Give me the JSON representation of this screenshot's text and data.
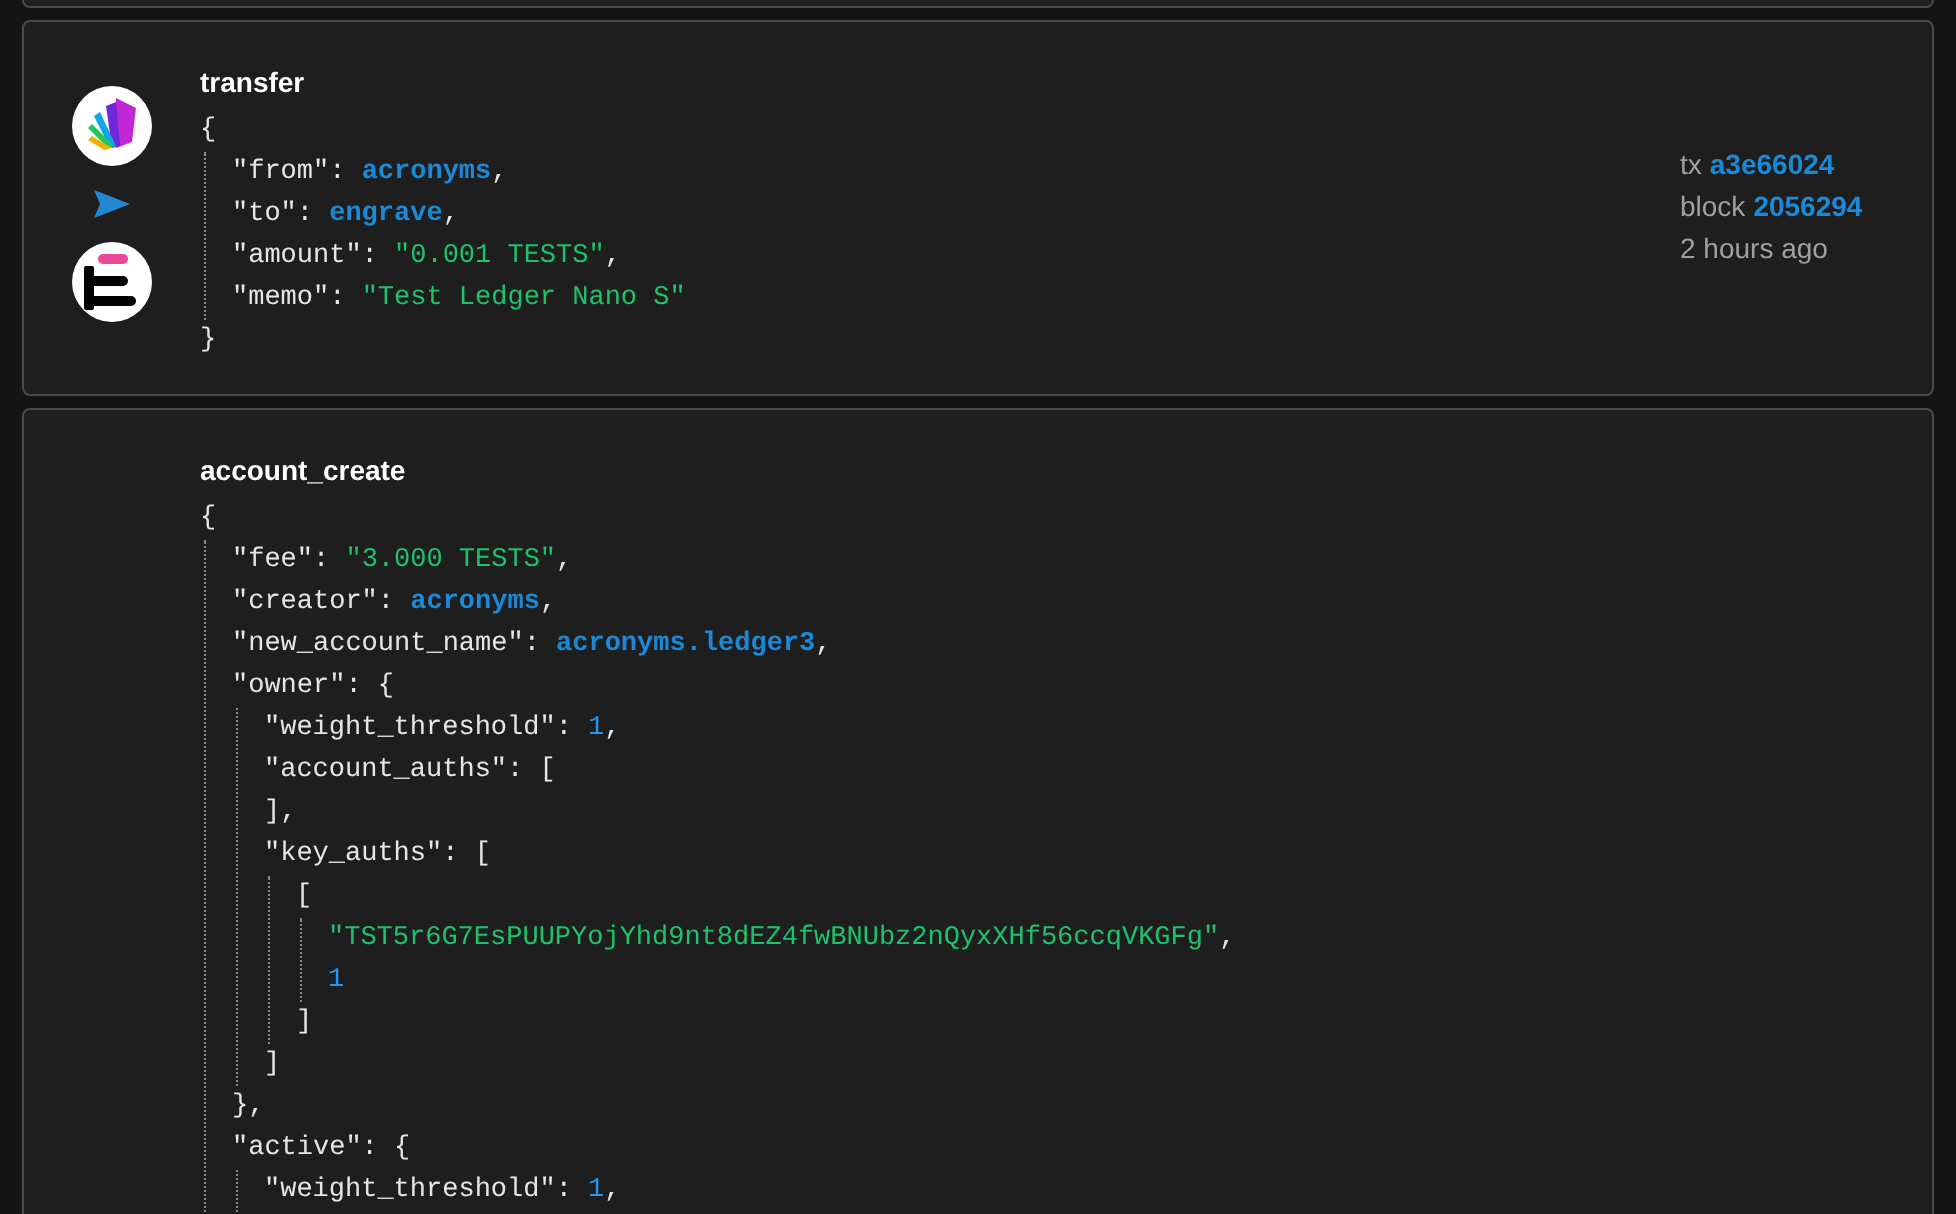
{
  "operations": [
    {
      "name": "transfer",
      "avatars": [
        {
          "kind": "fan"
        },
        {
          "kind": "bars"
        }
      ],
      "body": {
        "open": "{",
        "close": "}",
        "lines": [
          {
            "key": "\"from\": ",
            "value": "acronyms",
            "kind": "account",
            "tail": ","
          },
          {
            "key": "\"to\": ",
            "value": "engrave",
            "kind": "account",
            "tail": ","
          },
          {
            "key": "\"amount\": ",
            "value": "\"0.001 TESTS\"",
            "kind": "string",
            "tail": ","
          },
          {
            "key": "\"memo\": ",
            "value": "\"Test Ledger Nano S\"",
            "kind": "string"
          }
        ]
      },
      "meta": {
        "tx_label": "tx",
        "tx": "a3e66024",
        "block_label": "block",
        "block": "2056294",
        "time": "2 hours ago"
      }
    },
    {
      "name": "account_create",
      "body": {
        "open": "{",
        "lines": [
          {
            "key": "\"fee\": ",
            "value": "\"3.000 TESTS\"",
            "kind": "string",
            "tail": ","
          },
          {
            "key": "\"creator\": ",
            "value": "acronyms",
            "kind": "account",
            "tail": ","
          },
          {
            "key": "\"new_account_name\": ",
            "value": "acronyms.ledger3",
            "kind": "account",
            "tail": ","
          },
          {
            "key": "\"owner\": ",
            "open": "{",
            "close": "},",
            "lines": [
              {
                "key": "\"weight_threshold\": ",
                "value": "1",
                "kind": "number",
                "tail": ","
              },
              {
                "key": "\"account_auths\": ",
                "open": "[",
                "close": "],"
              },
              {
                "key": "\"key_auths\": ",
                "open": "[",
                "close": "]",
                "lines": [
                  {
                    "open": "[",
                    "close": "]",
                    "lines": [
                      {
                        "value": "\"TST5r6G7EsPUUPYojYhd9nt8dEZ4fwBNUbz2nQyxXHf56ccqVKGFg\"",
                        "kind": "string",
                        "tail": ","
                      },
                      {
                        "value": "1",
                        "kind": "number"
                      }
                    ]
                  }
                ]
              }
            ]
          },
          {
            "key": "\"active\": ",
            "open": "{",
            "lines": [
              {
                "key": "\"weight_threshold\": ",
                "value": "1",
                "kind": "number",
                "tail": ","
              }
            ]
          }
        ]
      }
    }
  ]
}
